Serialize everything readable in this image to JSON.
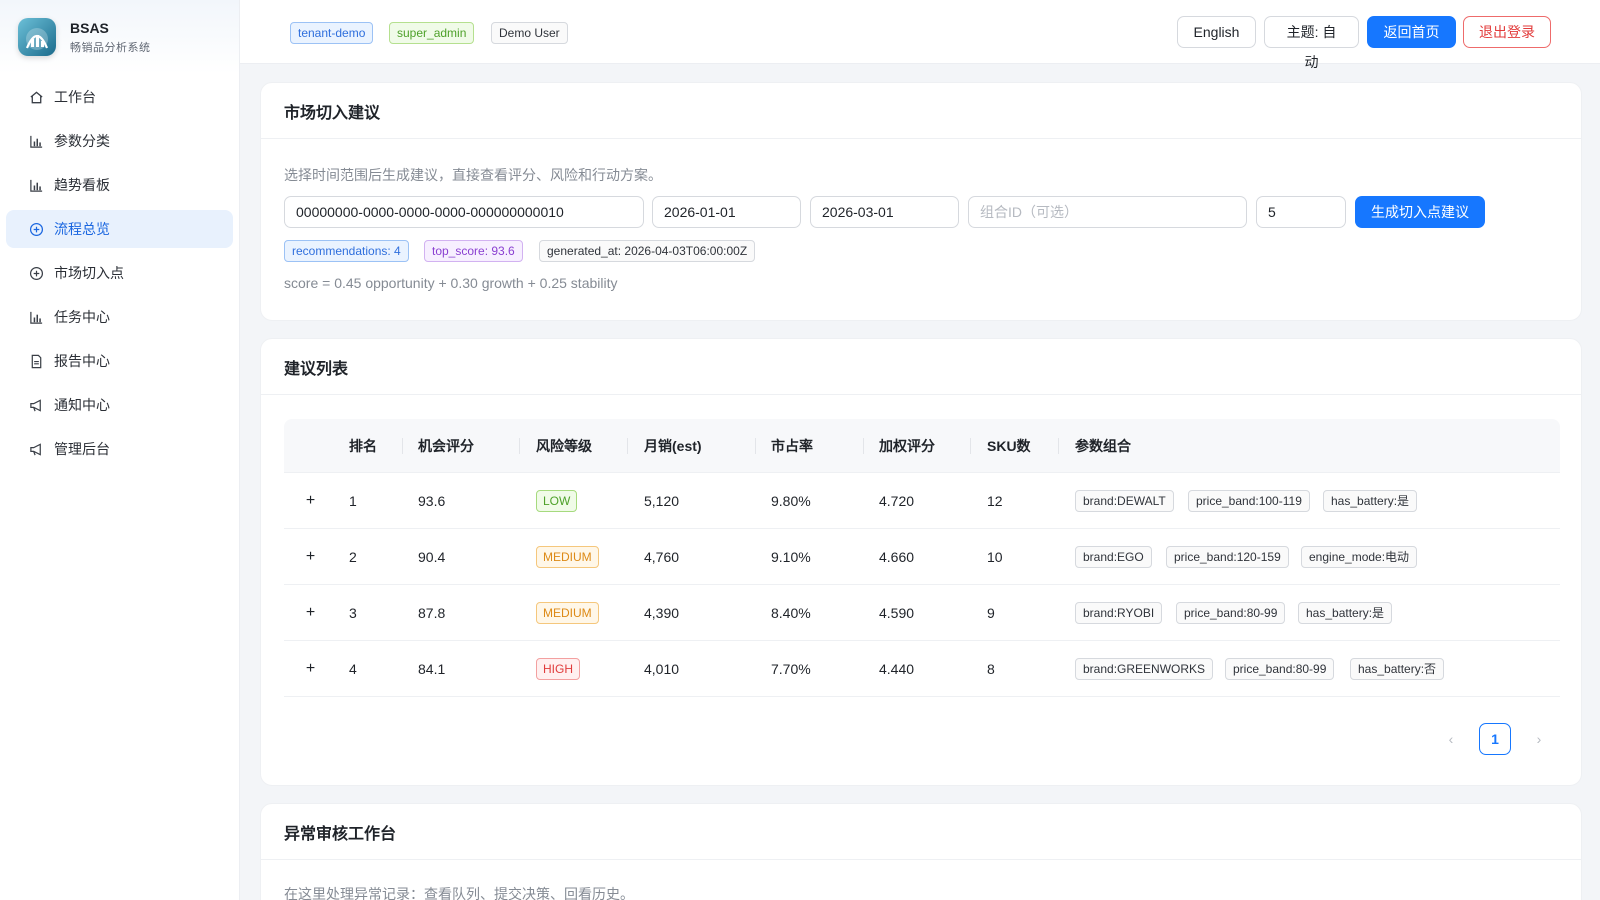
{
  "app": {
    "name": "BSAS",
    "subtitle": "畅销品分析系统"
  },
  "sidebar": {
    "items": [
      {
        "label": "工作台",
        "icon": "home-icon"
      },
      {
        "label": "参数分类",
        "icon": "bar-chart-icon"
      },
      {
        "label": "趋势看板",
        "icon": "bar-chart-icon"
      },
      {
        "label": "流程总览",
        "icon": "plus-circle-icon",
        "active": true
      },
      {
        "label": "市场切入点",
        "icon": "plus-circle-icon"
      },
      {
        "label": "任务中心",
        "icon": "bar-chart-icon"
      },
      {
        "label": "报告中心",
        "icon": "file-icon"
      },
      {
        "label": "通知中心",
        "icon": "megaphone-icon"
      },
      {
        "label": "管理后台",
        "icon": "megaphone-icon"
      }
    ]
  },
  "header": {
    "tags": [
      "tenant-demo",
      "super_admin",
      "Demo User"
    ],
    "buttons": {
      "language": "English",
      "theme": "主题: 自动",
      "home": "返回首页",
      "logout": "退出登录"
    }
  },
  "entry_card": {
    "title": "市场切入建议",
    "hint": "选择时间范围后生成建议，直接查看评分、风险和行动方案。",
    "inputs": {
      "tenant_id": "00000000-0000-0000-0000-000000000010",
      "start_date": "2026-01-01",
      "end_date": "2026-03-01",
      "combo_placeholder": "组合ID（可选）",
      "top_n": "5"
    },
    "generate_button": "生成切入点建议",
    "stats": {
      "recommendations": "recommendations: 4",
      "top_score": "top_score: 93.6",
      "generated_at": "generated_at: 2026-04-03T06:00:00Z"
    },
    "formula": "score = 0.45 opportunity + 0.30 growth + 0.25 stability"
  },
  "list_card": {
    "title": "建议列表",
    "columns": [
      "排名",
      "机会评分",
      "风险等级",
      "月销(est)",
      "市占率",
      "加权评分",
      "SKU数",
      "参数组合"
    ],
    "rows": [
      {
        "rank": "1",
        "opportunity": "93.6",
        "risk": "LOW",
        "risk_level": "low",
        "monthly_sales": "5,120",
        "share": "9.80%",
        "weighted": "4.720",
        "sku": "12",
        "params": [
          "brand:DEWALT",
          "price_band:100-119",
          "has_battery:是"
        ]
      },
      {
        "rank": "2",
        "opportunity": "90.4",
        "risk": "MEDIUM",
        "risk_level": "medium",
        "monthly_sales": "4,760",
        "share": "9.10%",
        "weighted": "4.660",
        "sku": "10",
        "params": [
          "brand:EGO",
          "price_band:120-159",
          "engine_mode:电动"
        ]
      },
      {
        "rank": "3",
        "opportunity": "87.8",
        "risk": "MEDIUM",
        "risk_level": "medium",
        "monthly_sales": "4,390",
        "share": "8.40%",
        "weighted": "4.590",
        "sku": "9",
        "params": [
          "brand:RYOBI",
          "price_band:80-99",
          "has_battery:是"
        ]
      },
      {
        "rank": "4",
        "opportunity": "84.1",
        "risk": "HIGH",
        "risk_level": "high",
        "monthly_sales": "4,010",
        "share": "7.70%",
        "weighted": "4.440",
        "sku": "8",
        "params": [
          "brand:GREENWORKS",
          "price_band:80-99",
          "has_battery:否"
        ]
      }
    ],
    "expand_symbol": "+",
    "pagination": {
      "current": "1",
      "prev": "‹",
      "next": "›"
    }
  },
  "review_card": {
    "title": "异常审核工作台",
    "hint": "在这里处理异常记录：查看队列、提交决策、回看历史。"
  },
  "colors": {
    "primary": "#1677ff",
    "active_nav_bg": "#e8f1fd",
    "danger": "#e23b3b"
  }
}
